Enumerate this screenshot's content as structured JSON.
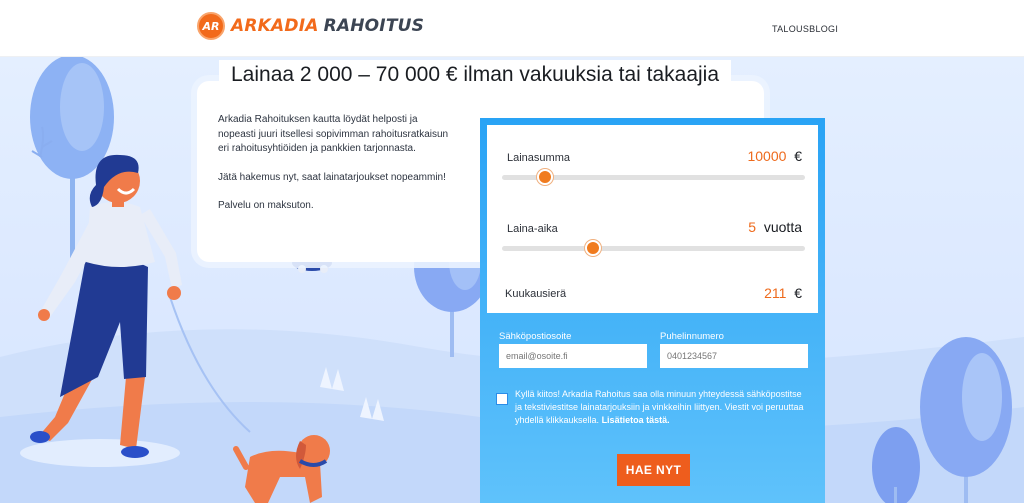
{
  "brand": {
    "badge": "AR",
    "name_part1": "ARKADIA",
    "name_part2": "RAHOITUS",
    "accent": "#f26a1b"
  },
  "nav": {
    "blog": "TALOUSBLOGI"
  },
  "headline": "Lainaa 2 000 – 70 000 € ilman vakuuksia tai takaajia",
  "intro": {
    "paragraph1": "Arkadia Rahoituksen kautta löydät helposti ja nopeasti juuri itsellesi sopivimman rahoitusratkaisun eri rahoitusyhtiöiden ja pankkien tarjonnasta.",
    "paragraph2": "Jätä hakemus nyt, saat lainatarjoukset nopeammin!",
    "paragraph3": "Palvelu on maksuton."
  },
  "calculator": {
    "amount": {
      "label": "Lainasumma",
      "value": "10000",
      "unit": "€",
      "slider_fraction": 0.14
    },
    "term": {
      "label": "Laina-aika",
      "value": "5",
      "unit": "vuotta",
      "slider_fraction": 0.3
    },
    "monthly": {
      "label": "Kuukausierä",
      "value": "211",
      "unit": "€"
    }
  },
  "contact": {
    "email": {
      "label": "Sähköpostiosoite",
      "placeholder": "email@osoite.fi"
    },
    "phone": {
      "label": "Puhelinnumero",
      "placeholder": "0401234567"
    }
  },
  "consent": {
    "checked": false,
    "text": "Kyllä kiitos! Arkadia Rahoitus saa olla minuun yhteydessä sähköpostitse ja tekstiviestitse lainatarjouksiin ja vinkkeihin liittyen. Viestit voi peruuttaa yhdellä klikkauksella.",
    "link": "Lisätietoa tästä."
  },
  "submit_label": "HAE NYT",
  "colors": {
    "form_top": "#29a3f5",
    "form_bottom": "#5fc2fb",
    "orange": "#ee5d1d",
    "scene": "#dbe8ff"
  }
}
